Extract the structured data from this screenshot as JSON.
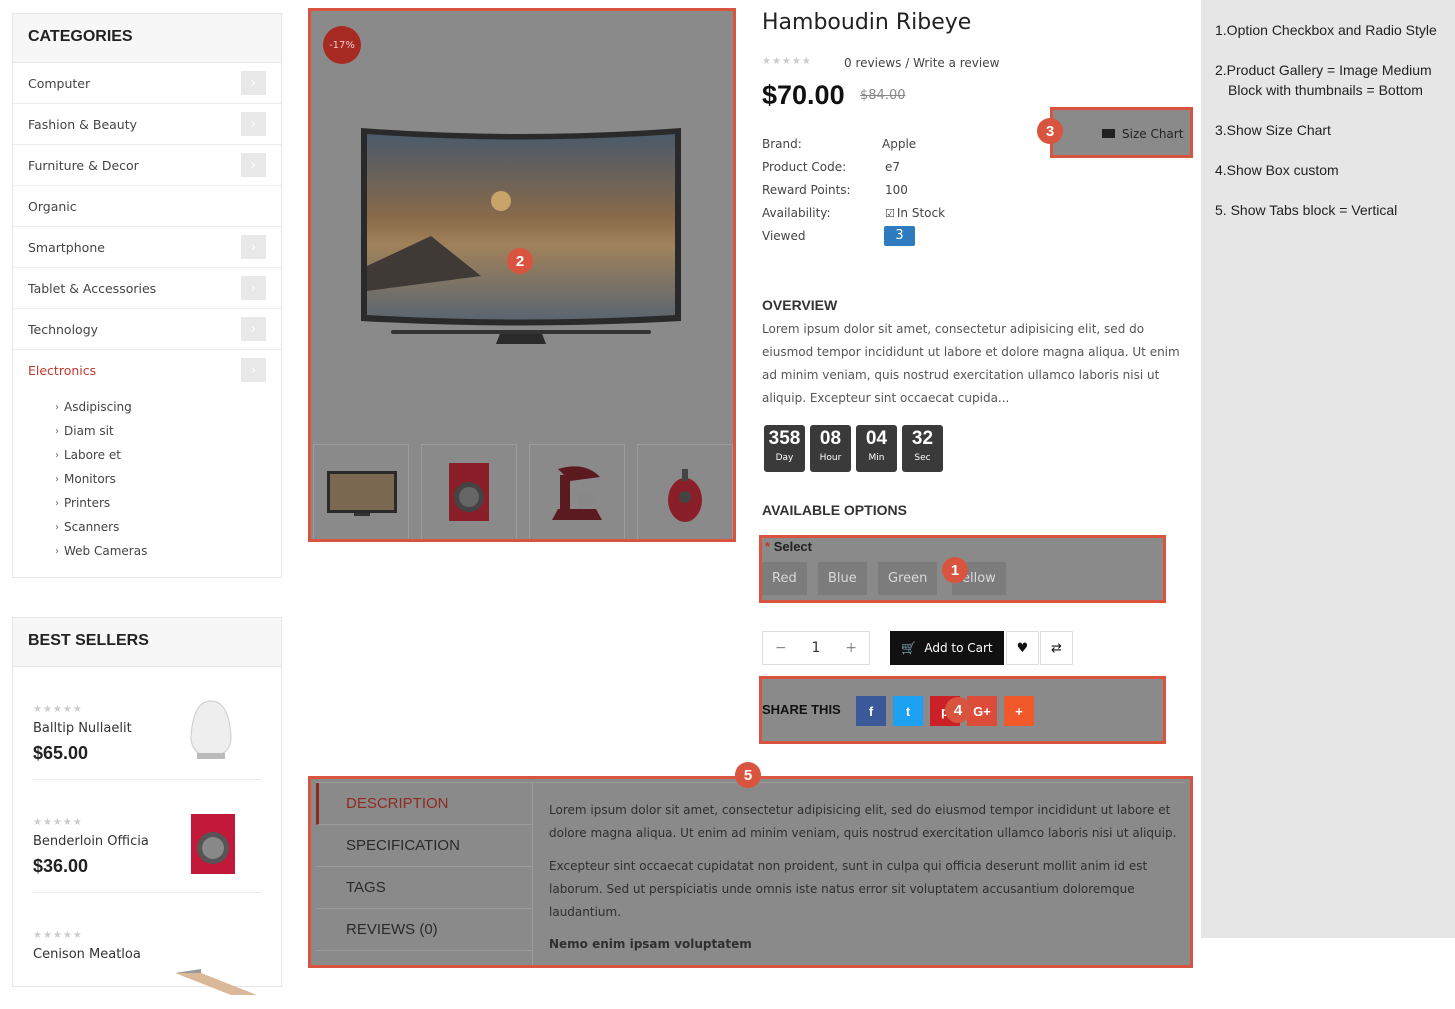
{
  "categories": {
    "title": "CATEGORIES",
    "items": [
      {
        "label": "Computer",
        "has_children": true
      },
      {
        "label": "Fashion & Beauty",
        "has_children": true
      },
      {
        "label": "Furniture & Decor",
        "has_children": true
      },
      {
        "label": "Organic",
        "has_children": false
      },
      {
        "label": "Smartphone",
        "has_children": true
      },
      {
        "label": "Tablet & Accessories",
        "has_children": true
      },
      {
        "label": "Technology",
        "has_children": true
      },
      {
        "label": "Electronics",
        "has_children": true,
        "active": true
      }
    ],
    "sub_items": [
      "Asdipiscing",
      "Diam sit",
      "Labore et",
      "Monitors",
      "Printers",
      "Scanners",
      "Web Cameras"
    ]
  },
  "best_sellers": {
    "title": "BEST SELLERS",
    "items": [
      {
        "name": "Balltip Nullaelit",
        "price": "$65.00",
        "rating": 0
      },
      {
        "name": "Benderloin Officia",
        "price": "$36.00",
        "rating": 0
      },
      {
        "name": "Cenison Meatloa",
        "price": "",
        "rating": 0
      }
    ]
  },
  "gallery": {
    "discount_badge": "-17%",
    "thumbnails": [
      "tv-thumb",
      "washer-thumb",
      "mixer-thumb",
      "vacuum-thumb"
    ]
  },
  "product": {
    "title": "Hamboudin Ribeye",
    "reviews_link": "0 reviews",
    "separator": "/",
    "write_review_link": "Write a review",
    "price": "$70.00",
    "old_price": "$84.00",
    "size_chart_label": "Size Chart",
    "details": [
      {
        "label": "Brand:",
        "value": "Apple"
      },
      {
        "label": "Product Code:",
        "value": "e7"
      },
      {
        "label": "Reward Points:",
        "value": "100"
      },
      {
        "label": "Availability:",
        "value": "In Stock"
      },
      {
        "label": "Viewed",
        "value": "3"
      }
    ],
    "overview_title": "OVERVIEW",
    "overview_text": "Lorem ipsum dolor sit amet, consectetur adipisicing elit, sed do eiusmod tempor incididunt ut labore et dolore magna aliqua. Ut enim ad minim veniam, quis nostrud exercitation ullamco laboris nisi ut aliquip. Excepteur sint occaecat cupida...",
    "countdown": [
      {
        "value": "358",
        "unit": "Day"
      },
      {
        "value": "08",
        "unit": "Hour"
      },
      {
        "value": "04",
        "unit": "Min"
      },
      {
        "value": "32",
        "unit": "Sec"
      }
    ],
    "options_title": "AVAILABLE OPTIONS",
    "select_required": "*",
    "select_label": "Select",
    "options": [
      "Red",
      "Blue",
      "Green",
      "ellow"
    ],
    "quantity": "1",
    "qty_minus": "−",
    "qty_plus": "+",
    "add_to_cart": "Add to Cart",
    "share_label": "SHARE THIS",
    "share_buttons": [
      {
        "icon": "facebook-icon",
        "glyph": "f",
        "color": "#3b5998"
      },
      {
        "icon": "twitter-icon",
        "glyph": "t",
        "color": "#1da1f2"
      },
      {
        "icon": "pinterest-icon",
        "glyph": "p",
        "color": "#cb2027"
      },
      {
        "icon": "google-plus-icon",
        "glyph": "G+",
        "color": "#dd4b39"
      },
      {
        "icon": "share-more-icon",
        "glyph": "+",
        "color": "#f1592a"
      }
    ]
  },
  "tabs": {
    "items": [
      "DESCRIPTION",
      "SPECIFICATION",
      "TAGS",
      "REVIEWS (0)"
    ],
    "active": 0,
    "paragraph1": "Lorem ipsum dolor sit amet, consectetur adipisicing elit, sed do eiusmod tempor incididunt ut labore et dolore magna aliqua. Ut enim ad minim veniam, quis nostrud exercitation ullamco laboris nisi ut aliquip.",
    "paragraph2": "Excepteur sint occaecat cupidatat non proident, sunt in culpa qui officia deserunt mollit anim id est laborum. Sed ut perspiciatis unde omnis iste natus error sit voluptatem accusantium doloremque laudantium.",
    "bold_line": "Nemo enim ipsam voluptatem"
  },
  "callouts": [
    "1",
    "2",
    "3",
    "4",
    "5"
  ],
  "notes": [
    "1.Option Checkbox and Radio Style",
    "2.Product Gallery =  Image Medium",
    "Block with thumbnails = Bottom",
    "3.Show Size Chart",
    "4.Show Box custom",
    "5. Show Tabs block = Vertical"
  ],
  "colors": {
    "accent": "#d9543f",
    "active_link": "#c0392b",
    "viewed_badge": "#2f7bbf"
  }
}
